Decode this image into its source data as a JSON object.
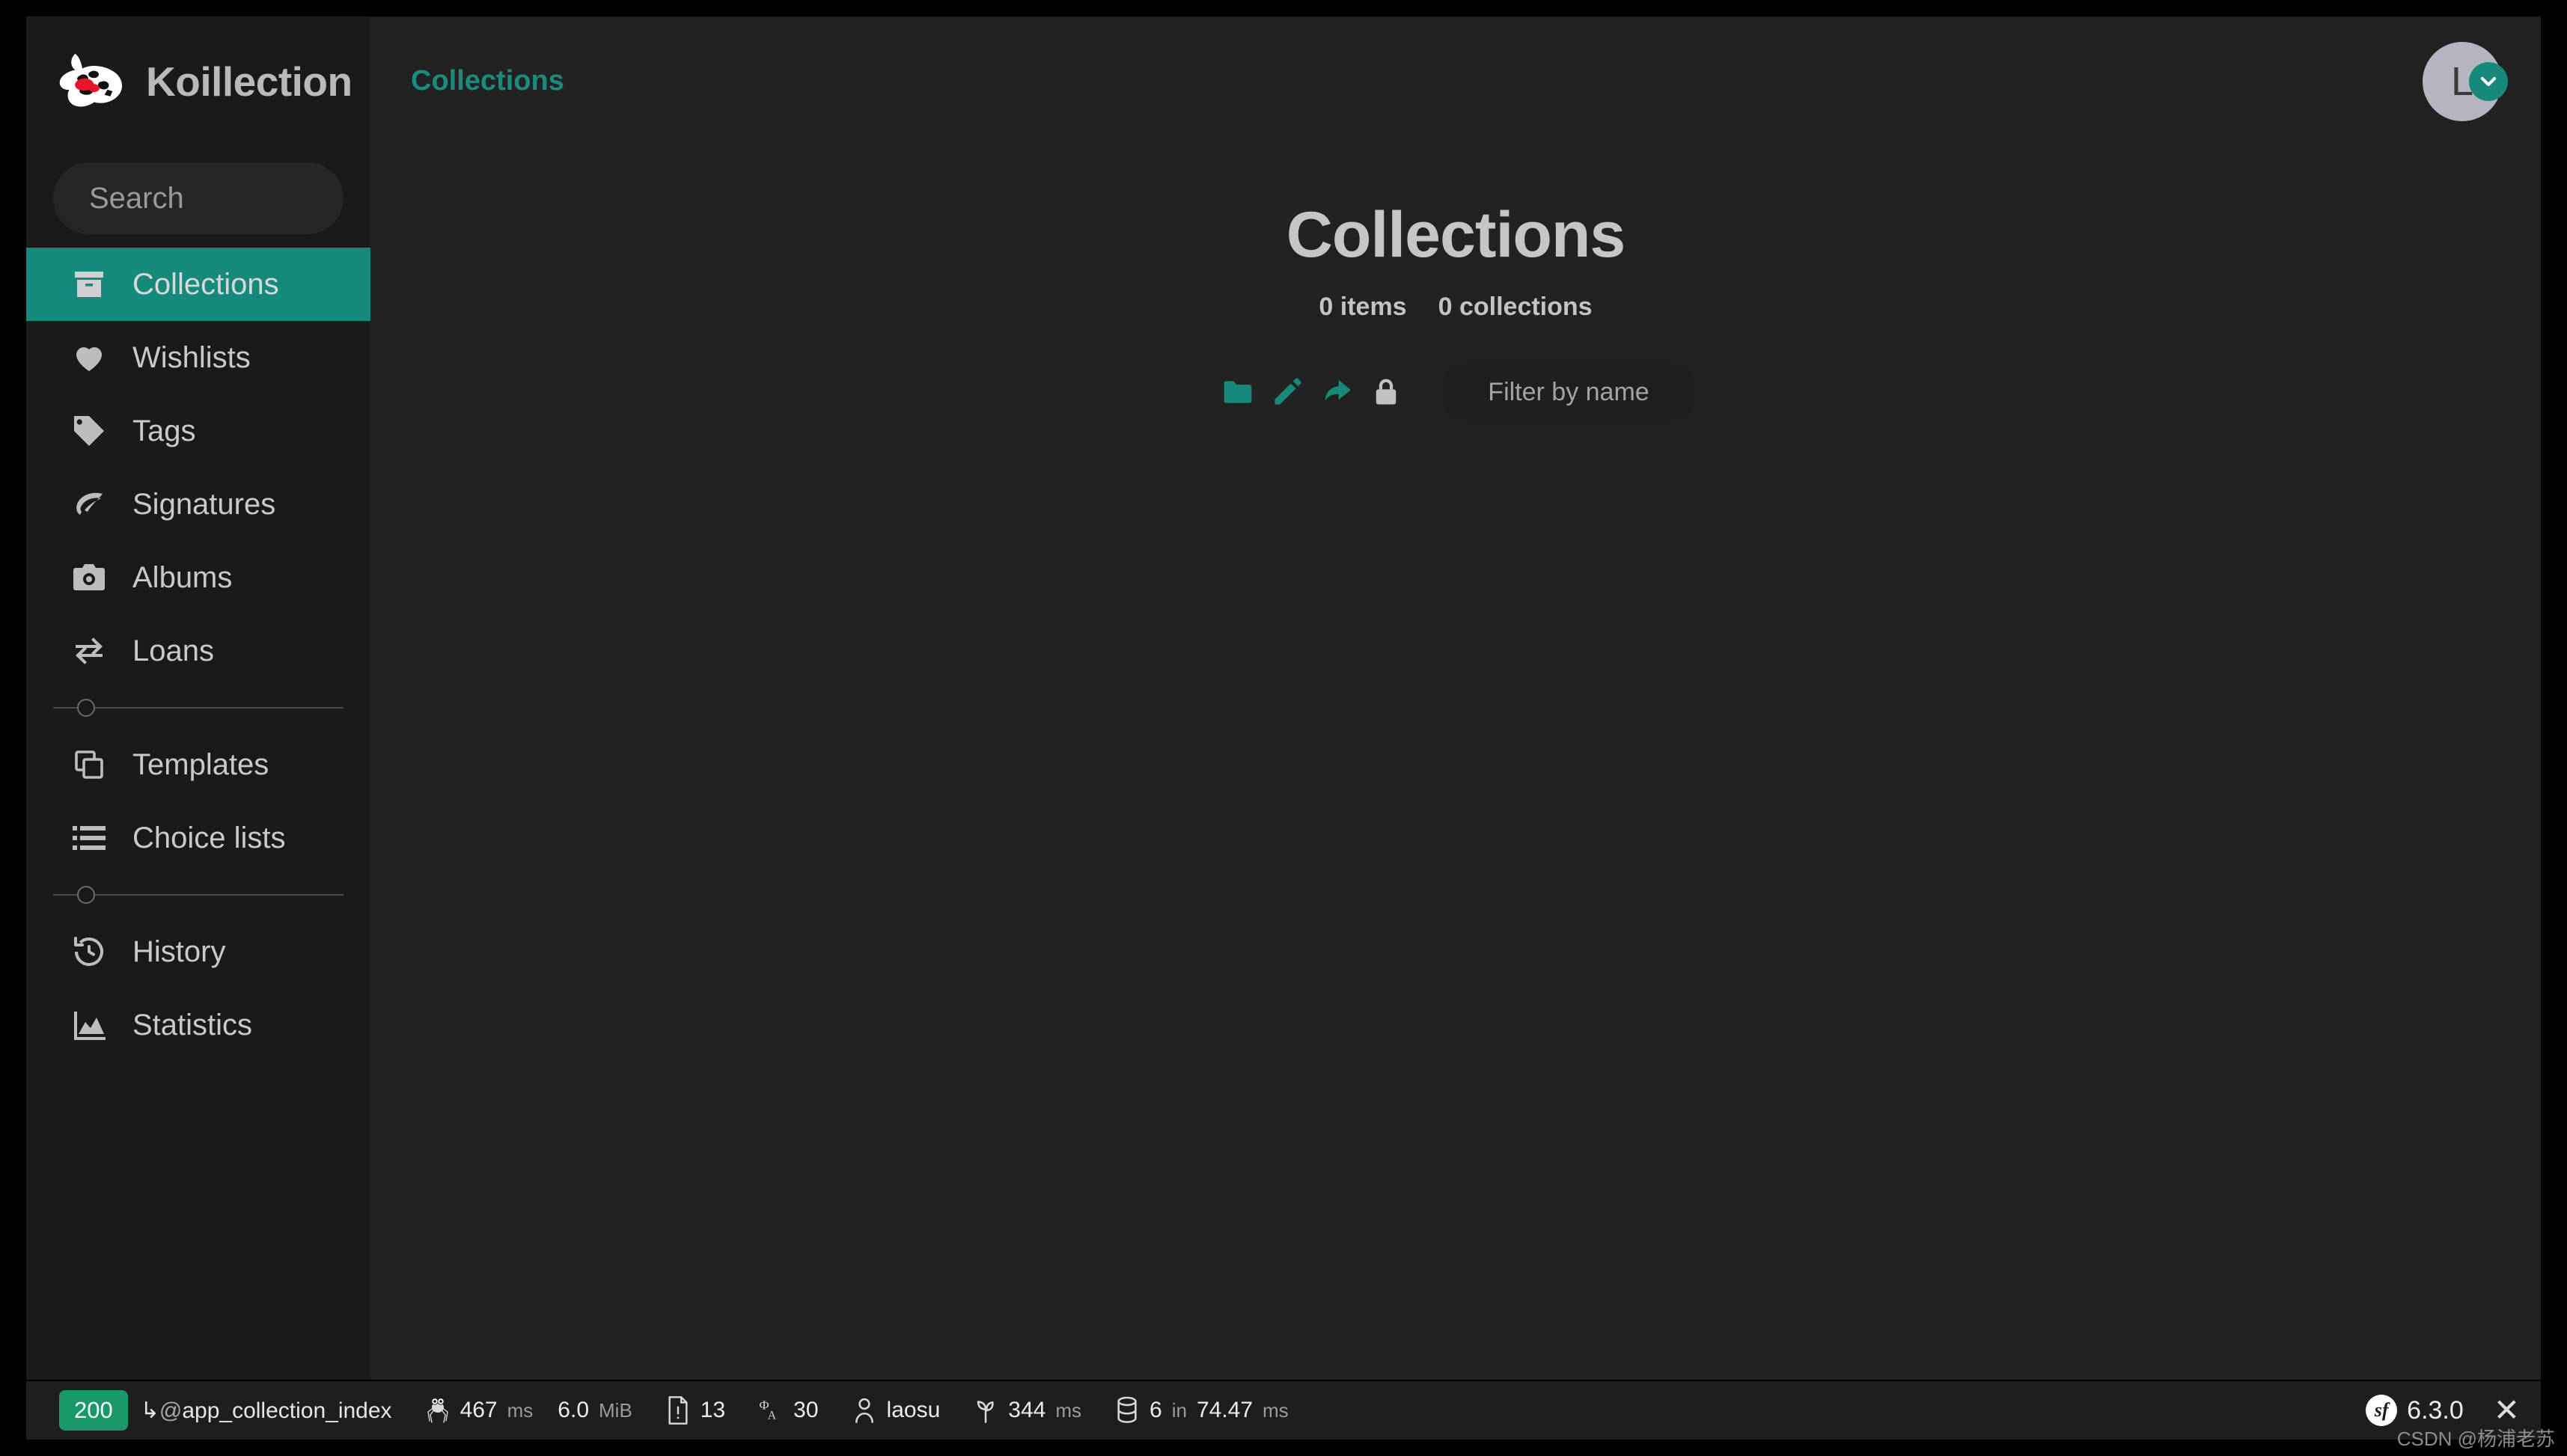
{
  "colors": {
    "accent_teal": "#15897a",
    "breadcrumb_teal": "#1b8c7b",
    "sidebar_bg": "#1a1a1a",
    "content_bg": "#222222",
    "status_green": "#19996a",
    "page_margin": "#000000"
  },
  "sidebar": {
    "brand": {
      "name": "Koillection",
      "logo_icon": "koi-fish-logo"
    },
    "search": {
      "placeholder": "Search",
      "value": "",
      "icon": "search-input"
    },
    "groups": [
      {
        "items": [
          {
            "label": "Collections",
            "icon": "archive-box-icon",
            "active": true
          },
          {
            "label": "Wishlists",
            "icon": "heart-icon",
            "active": false
          },
          {
            "label": "Tags",
            "icon": "tag-icon",
            "active": false
          },
          {
            "label": "Signatures",
            "icon": "leaf-icon",
            "active": false
          },
          {
            "label": "Albums",
            "icon": "camera-icon",
            "active": false
          },
          {
            "label": "Loans",
            "icon": "exchange-arrows-icon",
            "active": false
          }
        ]
      },
      {
        "items": [
          {
            "label": "Templates",
            "icon": "copy-icon",
            "active": false
          },
          {
            "label": "Choice lists",
            "icon": "list-icon",
            "active": false
          }
        ]
      },
      {
        "items": [
          {
            "label": "History",
            "icon": "history-clock-icon",
            "active": false
          },
          {
            "label": "Statistics",
            "icon": "chart-area-icon",
            "active": false
          }
        ]
      }
    ]
  },
  "topbar": {
    "breadcrumb": "Collections",
    "avatar": {
      "initial": "L",
      "badge_icon": "chevron-down-icon"
    }
  },
  "main": {
    "title": "Collections",
    "counts": {
      "items": "0 items",
      "collections": "0 collections"
    },
    "toolbar": {
      "buttons": [
        {
          "name": "new-collection-button",
          "icon": "folder-icon",
          "color": "#16897a"
        },
        {
          "name": "edit-button",
          "icon": "pencil-icon",
          "color": "#16897a"
        },
        {
          "name": "share-button",
          "icon": "share-arrow-icon",
          "color": "#16897a"
        },
        {
          "name": "visibility-button",
          "icon": "lock-icon",
          "color": "#c2c2c2"
        }
      ],
      "filter": {
        "placeholder": "Filter by name",
        "value": ""
      }
    }
  },
  "debug_toolbar": {
    "status_code": "200",
    "route_arrow": "↳",
    "route_at": "@",
    "route_name": "app_collection_index",
    "spider_icon": "symfony-spider-icon",
    "metrics": [
      {
        "icon": "clock-metric",
        "value": "467",
        "unit": "ms"
      },
      {
        "icon": "memory-metric",
        "value": "6.0",
        "unit": "MiB"
      },
      {
        "icon": "file-warning-icon",
        "value": "13",
        "unit": ""
      },
      {
        "icon": "translation-icon",
        "value": "30",
        "unit": ""
      },
      {
        "icon": "user-icon",
        "value": "laosu",
        "unit": ""
      },
      {
        "icon": "twig-sprout-icon",
        "value": "344",
        "unit": "ms"
      },
      {
        "icon": "database-icon",
        "value": "6",
        "unit": "in",
        "value2": "74.47",
        "unit2": "ms"
      }
    ],
    "version": "6.3.0",
    "logo": "sf",
    "close_icon": "close-icon"
  },
  "watermark": "CSDN @杨浦老苏"
}
